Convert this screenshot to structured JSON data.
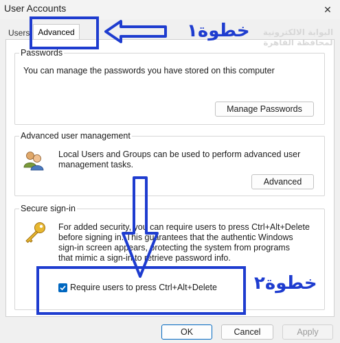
{
  "window": {
    "title": "User Accounts",
    "close_icon": "close-icon"
  },
  "tabs": [
    {
      "label": "Users",
      "selected": false
    },
    {
      "label": "Advanced",
      "selected": true
    }
  ],
  "passwords": {
    "group_label": "Passwords",
    "description": "You can manage the passwords you have stored on this computer",
    "button_label": "Manage Passwords"
  },
  "advanced_user_management": {
    "group_label": "Advanced user management",
    "description_line1": "Local Users and Groups can be used to perform advanced user",
    "description_line2": "management tasks.",
    "icon": "users-group-icon",
    "button_label": "Advanced"
  },
  "secure_signin": {
    "group_label": "Secure sign-in",
    "description_line1": "For added security, you can require users to press Ctrl+Alt+Delete",
    "description_line2": "before signing in. This guarantees that the authentic Windows",
    "description_line3": "sign-in screen appears, protecting the system from programs",
    "description_line4": "that mimic a sign-in to retrieve password info.",
    "icon": "key-icon",
    "checkbox_label": "Require users to press Ctrl+Alt+Delete",
    "checkbox_checked": true
  },
  "footer": {
    "ok_label": "OK",
    "cancel_label": "Cancel",
    "apply_label": "Apply"
  },
  "annotations": {
    "step1": "خطوة١",
    "step2": "خطوة٢",
    "watermark_line1": "البوابة الالكترونية",
    "watermark_line2": "لمحافظة القاهرة",
    "color": "#1e3ccf"
  }
}
